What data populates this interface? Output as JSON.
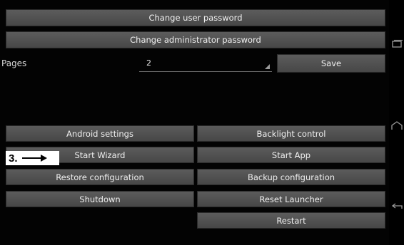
{
  "account": {
    "change_user_password": "Change user password",
    "change_admin_password": "Change administrator password"
  },
  "pages": {
    "label": "Pages",
    "value": "2",
    "save_label": "Save"
  },
  "actions": {
    "android_settings": "Android settings",
    "backlight_control": "Backlight control",
    "start_wizard": "Start Wizard",
    "start_app": "Start App",
    "restore_configuration": "Restore configuration",
    "backup_configuration": "Backup configuration",
    "shutdown": "Shutdown",
    "reset_launcher": "Reset Launcher",
    "restart": "Restart"
  },
  "annotation": {
    "step_label": "3."
  },
  "nav_icons": [
    "recent-apps-icon",
    "home-icon",
    "back-icon"
  ]
}
